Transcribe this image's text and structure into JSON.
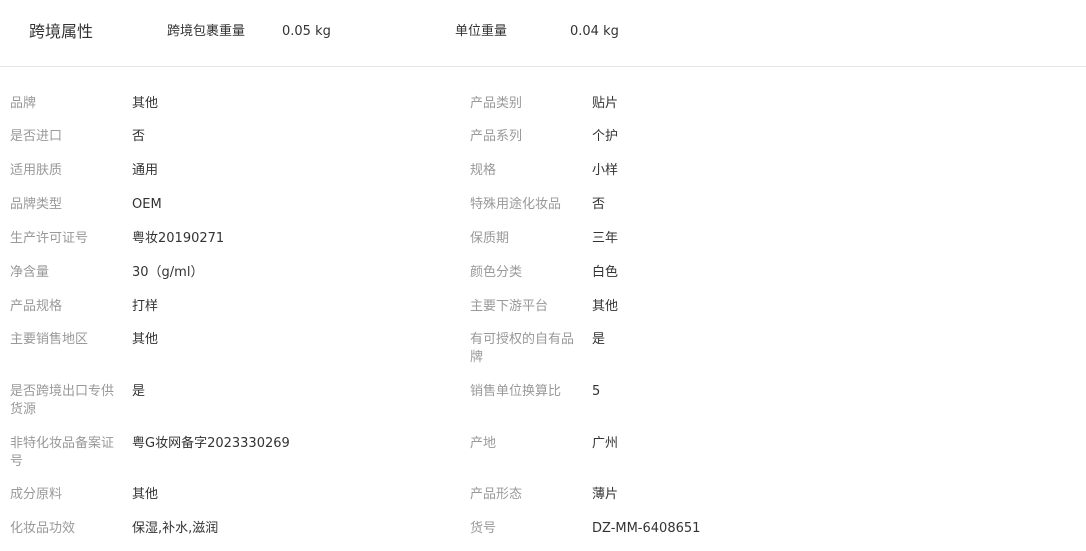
{
  "header": {
    "title": "跨境属性",
    "fields": [
      {
        "label": "跨境包裹重量",
        "value": "0.05 kg"
      },
      {
        "label": "单位重量",
        "value": "0.04 kg"
      }
    ]
  },
  "left": [
    {
      "label": "品牌",
      "value": "其他"
    },
    {
      "label": "是否进口",
      "value": "否"
    },
    {
      "label": "适用肤质",
      "value": "通用"
    },
    {
      "label": "品牌类型",
      "value": "OEM"
    },
    {
      "label": "生产许可证号",
      "value": "粤妆20190271"
    },
    {
      "label": "净含量",
      "value": "30（g/ml）"
    },
    {
      "label": "产品规格",
      "value": "打样"
    },
    {
      "label": "主要销售地区",
      "value": "其他"
    },
    {
      "label": "是否跨境出口专供货源",
      "value": "是"
    },
    {
      "label": "非特化妆品备案证号",
      "value": "粤G妆网备字2023330269"
    },
    {
      "label": "成分原料",
      "value": "其他"
    },
    {
      "label": "化妆品功效",
      "value": "保湿,补水,滋润"
    }
  ],
  "right": [
    {
      "label": "产品类别",
      "value": "贴片"
    },
    {
      "label": "产品系列",
      "value": "个护"
    },
    {
      "label": "规格",
      "value": "小样"
    },
    {
      "label": "特殊用途化妆品",
      "value": "否"
    },
    {
      "label": "保质期",
      "value": "三年"
    },
    {
      "label": "颜色分类",
      "value": "白色"
    },
    {
      "label": "主要下游平台",
      "value": "其他"
    },
    {
      "label": "有可授权的自有品牌",
      "value": "是"
    },
    {
      "label": "销售单位换算比",
      "value": "5"
    },
    {
      "label": "产地",
      "value": "广州"
    },
    {
      "label": "产品形态",
      "value": "薄片"
    },
    {
      "label": "货号",
      "value": "DZ-MM-6408651"
    }
  ]
}
